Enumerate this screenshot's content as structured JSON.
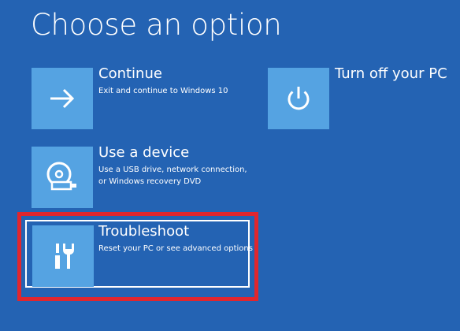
{
  "page": {
    "title": "Choose an option"
  },
  "options": {
    "continue": {
      "title": "Continue",
      "description": "Exit and continue to Windows 10",
      "icon": "arrow-right-icon"
    },
    "use_device": {
      "title": "Use a device",
      "description_line1": "Use a USB drive, network connection,",
      "description_line2": "or Windows recovery DVD",
      "icon": "disc-usb-icon"
    },
    "troubleshoot": {
      "title": "Troubleshoot",
      "description": "Reset your PC or see advanced options",
      "icon": "tools-icon"
    },
    "turn_off": {
      "title": "Turn off your PC",
      "icon": "power-icon"
    }
  },
  "colors": {
    "background": "#2463b3",
    "tile": "#55a3e2",
    "highlight": "#e0262e",
    "text": "#ffffff"
  }
}
